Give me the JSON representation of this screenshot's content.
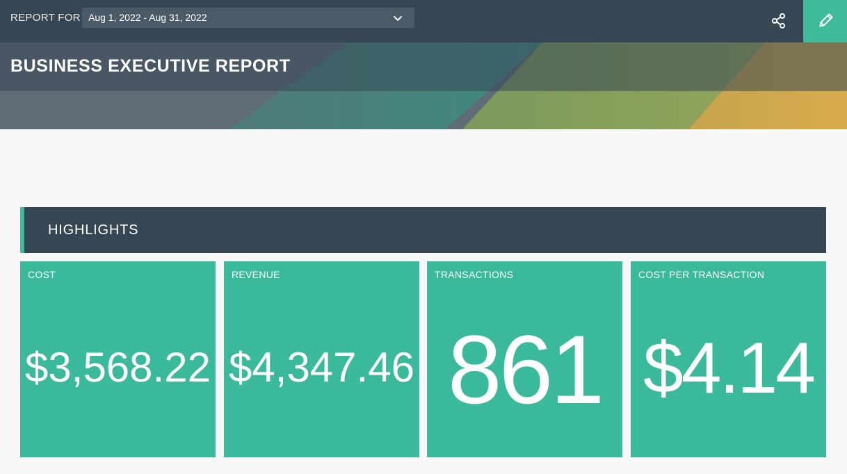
{
  "topbar": {
    "report_for_label": "REPORT FOR",
    "date_range": "Aug 1, 2022 - Aug 31, 2022",
    "share_icon": "share-icon",
    "edit_icon": "pencil-icon"
  },
  "banner": {
    "title": "BUSINESS EXECUTIVE REPORT"
  },
  "highlights": {
    "title": "HIGHLIGHTS",
    "tiles": [
      {
        "label": "COST",
        "value": "$3,568.22"
      },
      {
        "label": "REVENUE",
        "value": "$4,347.46"
      },
      {
        "label": "TRANSACTIONS",
        "value": "861"
      },
      {
        "label": "COST PER TRANSACTION",
        "value": "$4.14"
      }
    ]
  },
  "colors": {
    "header_bg": "#364753",
    "accent": "#3dbb9b",
    "tile_bg": "#3bba9b",
    "page_bg": "#f8f8f8"
  }
}
